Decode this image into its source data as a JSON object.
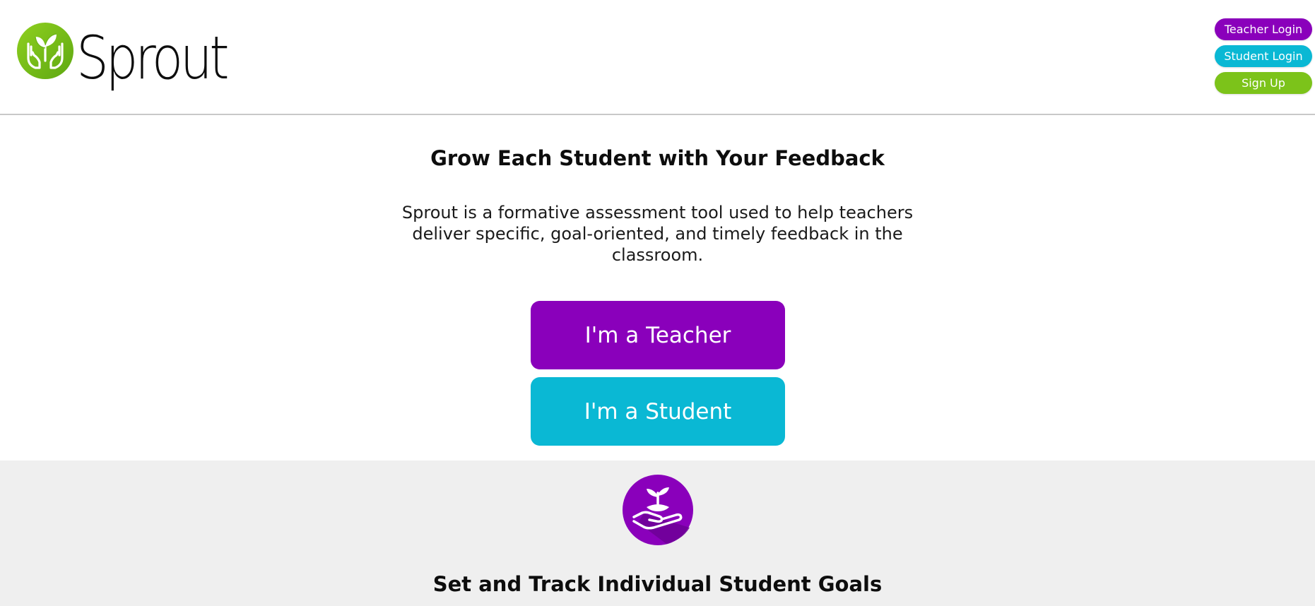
{
  "brand": {
    "name": "Sprout",
    "colors": {
      "green": "#7cc31a",
      "purple": "#8a00bb",
      "cyan": "#0ab8d4"
    }
  },
  "header": {
    "logo_icon": "hands-holding-sprout-icon",
    "auth_buttons": {
      "teacher_login": "Teacher Login",
      "student_login": "Student Login",
      "sign_up": "Sign Up"
    }
  },
  "hero": {
    "title": "Grow Each Student with Your Feedback",
    "description": "Sprout is a formative assessment tool used to help teachers deliver specific, goal-oriented, and timely feedback in the classroom.",
    "teacher_button": "I'm a Teacher",
    "student_button": "I'm a Student"
  },
  "feature": {
    "icon": "hand-holding-seedling-icon",
    "title": "Set and Track Individual Student Goals"
  }
}
